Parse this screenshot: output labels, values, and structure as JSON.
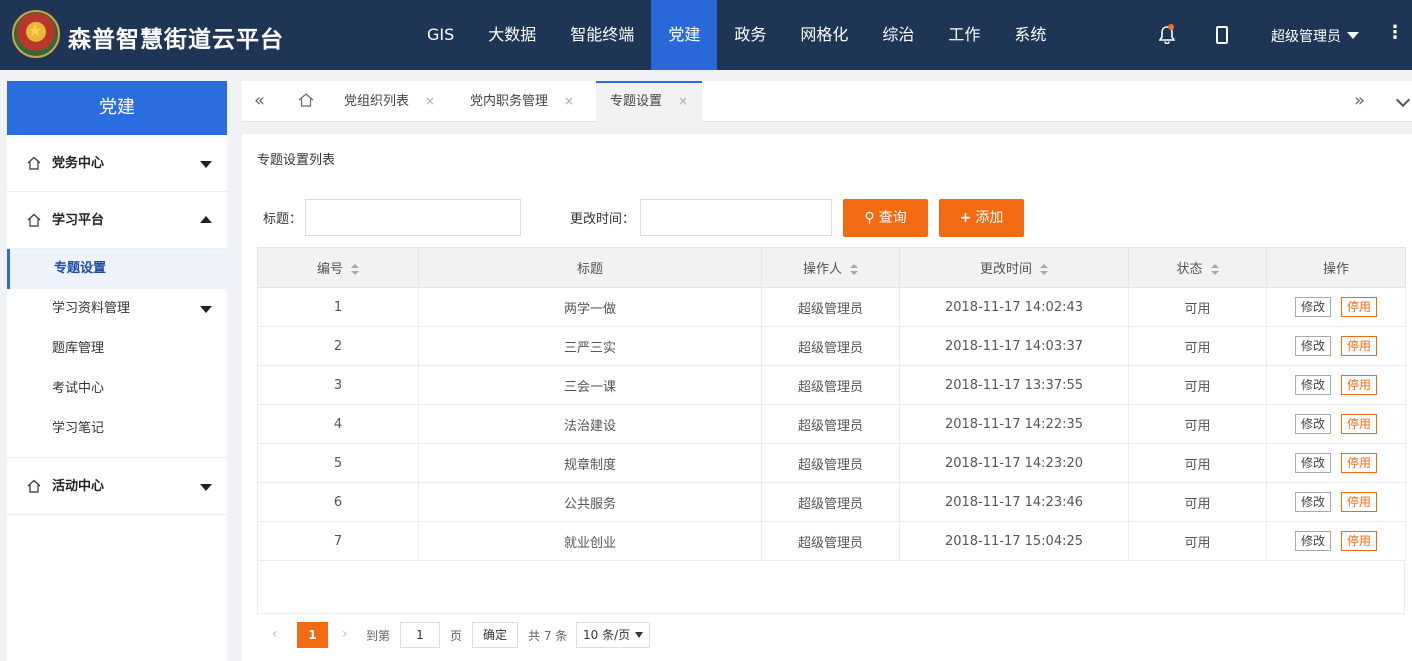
{
  "app": {
    "title": "森普智慧街道云平台"
  },
  "nav": [
    {
      "label": "GIS"
    },
    {
      "label": "大数据"
    },
    {
      "label": "智能终端"
    },
    {
      "label": "党建"
    },
    {
      "label": "政务"
    },
    {
      "label": "网格化"
    },
    {
      "label": "综治"
    },
    {
      "label": "工作"
    },
    {
      "label": "系统"
    }
  ],
  "nav_active": "党建",
  "user": {
    "name": "超级管理员"
  },
  "sidebar": {
    "header": "党建",
    "groups": [
      {
        "label": "党务中心",
        "expanded": false
      },
      {
        "label": "学习平台",
        "expanded": true,
        "items": [
          {
            "label": "专题设置",
            "active": true
          },
          {
            "label": "学习资料管理",
            "has_children": true
          },
          {
            "label": "题库管理"
          },
          {
            "label": "考试中心"
          },
          {
            "label": "学习笔记"
          }
        ]
      },
      {
        "label": "活动中心",
        "expanded": false
      }
    ]
  },
  "tabs": [
    {
      "label": "党组织列表",
      "close": "×"
    },
    {
      "label": "党内职务管理",
      "close": "×"
    },
    {
      "label": "专题设置",
      "close": "×",
      "active": true
    }
  ],
  "page": {
    "title": "专题设置列表",
    "filters": {
      "title_label": "标题：",
      "title_value": "",
      "time_label": "更改时间：",
      "time_value": ""
    },
    "buttons": {
      "query": "查询",
      "add": "添加"
    }
  },
  "table": {
    "columns": [
      "编号",
      "标题",
      "操作人",
      "更改时间",
      "状态",
      "操作"
    ],
    "rows": [
      {
        "id": "1",
        "title": "两学一做",
        "operator": "超级管理员",
        "time": "2018-11-17 14:02:43",
        "status": "可用",
        "edit": "修改",
        "disable": "停用"
      },
      {
        "id": "2",
        "title": "三严三实",
        "operator": "超级管理员",
        "time": "2018-11-17 14:03:37",
        "status": "可用",
        "edit": "修改",
        "disable": "停用"
      },
      {
        "id": "3",
        "title": "三会一课",
        "operator": "超级管理员",
        "time": "2018-11-17 13:37:55",
        "status": "可用",
        "edit": "修改",
        "disable": "停用"
      },
      {
        "id": "4",
        "title": "法治建设",
        "operator": "超级管理员",
        "time": "2018-11-17 14:22:35",
        "status": "可用",
        "edit": "修改",
        "disable": "停用"
      },
      {
        "id": "5",
        "title": "规章制度",
        "operator": "超级管理员",
        "time": "2018-11-17 14:23:20",
        "status": "可用",
        "edit": "修改",
        "disable": "停用"
      },
      {
        "id": "6",
        "title": "公共服务",
        "operator": "超级管理员",
        "time": "2018-11-17 14:23:46",
        "status": "可用",
        "edit": "修改",
        "disable": "停用"
      },
      {
        "id": "7",
        "title": "就业创业",
        "operator": "超级管理员",
        "time": "2018-11-17 15:04:25",
        "status": "可用",
        "edit": "修改",
        "disable": "停用"
      }
    ]
  },
  "pagination": {
    "current": "1",
    "goto_label": "到第",
    "goto_value": "1",
    "page_unit": "页",
    "confirm": "确定",
    "total": "共 7 条",
    "page_size": "10 条/页"
  },
  "colors": {
    "topbar": "#1f3556",
    "accent": "#2a6de0",
    "orange": "#f26b13"
  }
}
